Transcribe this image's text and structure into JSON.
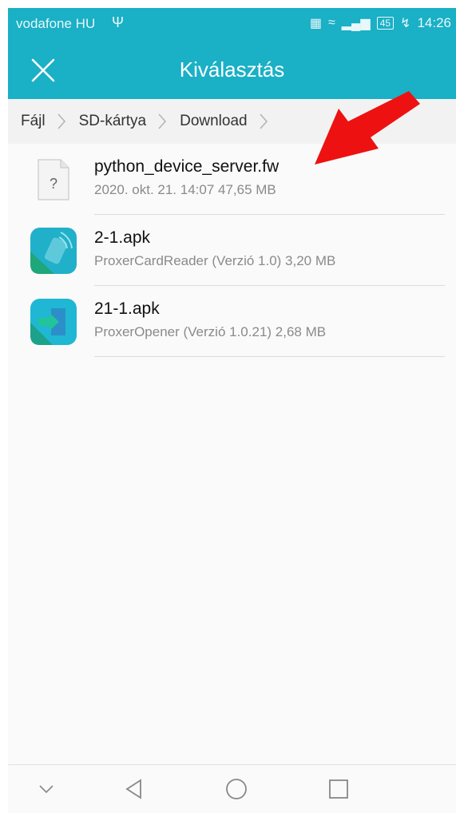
{
  "status_bar": {
    "carrier": "vodafone HU",
    "usb_icon": "usb-icon",
    "battery": "45",
    "time": "14:26"
  },
  "header": {
    "title": "Kiválasztás",
    "close_icon": "close-icon",
    "background_color": "#1ab0c6"
  },
  "breadcrumb": {
    "items": [
      "Fájl",
      "SD-kártya",
      "Download"
    ]
  },
  "files": [
    {
      "name": "python_device_server.fw",
      "meta": "2020. okt. 21. 14:07 47,65 MB",
      "icon": "unknown-file-icon"
    },
    {
      "name": "2-1.apk",
      "meta": "ProxerCardReader (Verzió 1.0) 3,20 MB",
      "icon": "proxer-card-reader-app-icon"
    },
    {
      "name": "21-1.apk",
      "meta": "ProxerOpener (Verzió 1.0.21) 2,68 MB",
      "icon": "proxer-opener-app-icon"
    }
  ],
  "annotation": {
    "color": "#ee1111",
    "icon": "red-arrow-annotation"
  },
  "navbar": {
    "icons": [
      "chevron-down-icon",
      "back-icon",
      "home-icon",
      "recents-icon"
    ]
  }
}
